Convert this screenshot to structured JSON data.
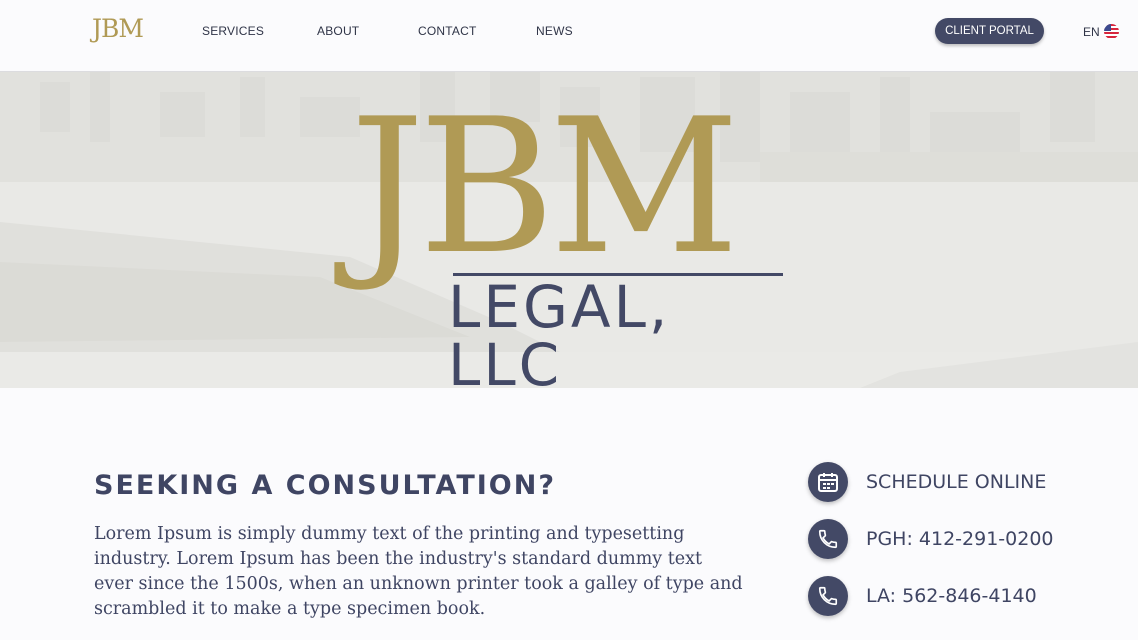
{
  "header": {
    "logo": "JBM",
    "nav": [
      "SERVICES",
      "ABOUT",
      "CONTACT",
      "NEWS"
    ],
    "portal_label": "CLIENT PORTAL",
    "language": "EN"
  },
  "hero": {
    "logo_top": "JBM",
    "logo_bottom": "LEGAL, LLC"
  },
  "consultation": {
    "title": "SEEKING A CONSULTATION?",
    "body": "Lorem Ipsum is simply dummy text of the printing and typesetting industry. Lorem Ipsum has been the industry's standard dummy text ever since the 1500s, when an unknown printer took a galley of type and scrambled it to make a type specimen book."
  },
  "contact": {
    "schedule": "SCHEDULE ONLINE",
    "pgh": "PGH: 412-291-0200",
    "la": "LA: 562-846-4140"
  },
  "colors": {
    "gold": "#b09a55",
    "navy": "#434966"
  }
}
